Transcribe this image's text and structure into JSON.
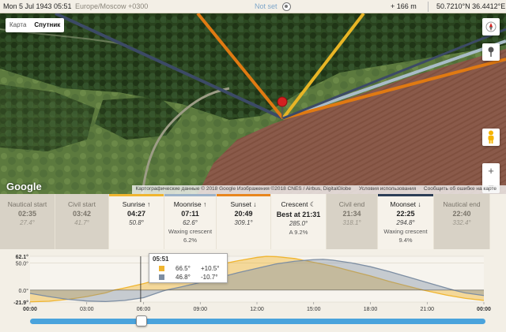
{
  "topbar": {
    "datetime": "Mon 5 Jul 1943 05:51",
    "timezone": "Europe/Moscow +0300",
    "notset": "Not set",
    "elevation": "+ 166 m",
    "coordinates": "50.7210°N 36.4412°E"
  },
  "map": {
    "type_labels": [
      "Карта",
      "Спутник"
    ],
    "active_type": "Спутник",
    "logo": "Google",
    "attribution": [
      "Картографические данные © 2018 Google Изображения ©2018 CNES / Airbus, DigitalGlobe",
      "Условия использования",
      "Сообщить об ошибке на карте"
    ],
    "zoom_in": "+",
    "zoom_out": "−"
  },
  "events": [
    {
      "name": "Nautical start",
      "time": "02:35",
      "sub": "27.4°",
      "style": "grey",
      "bar": ""
    },
    {
      "name": "Civil start",
      "time": "03:42",
      "sub": "41.7°",
      "style": "grey",
      "bar": ""
    },
    {
      "name": "Sunrise ↑",
      "time": "04:27",
      "sub": "50.8°",
      "style": "light",
      "bar": "#f0b530"
    },
    {
      "name": "Moonrise ↑",
      "time": "07:11",
      "sub": "62.6°",
      "sub2": "Waxing crescent",
      "sub3": "6.2%",
      "style": "light",
      "bar": "#9db3c9"
    },
    {
      "name": "Sunset ↓",
      "time": "20:49",
      "sub": "309.1°",
      "style": "light",
      "bar": "#e8861e"
    },
    {
      "name": "Crescent ☾",
      "time": "Best at 21:31",
      "sub": "285.0°",
      "sub2": "A 9.2%",
      "style": "light",
      "bar": ""
    },
    {
      "name": "Civil end",
      "time": "21:34",
      "sub": "318.1°",
      "style": "grey",
      "bar": ""
    },
    {
      "name": "Moonset ↓",
      "time": "22:25",
      "sub": "294.8°",
      "sub2": "Waxing crescent",
      "sub3": "9.4%",
      "style": "light",
      "bar": "#2c3e56"
    },
    {
      "name": "Nautical end",
      "time": "22:40",
      "sub": "332.4°",
      "style": "grey",
      "bar": ""
    }
  ],
  "tooltip": {
    "time": "05:51",
    "rows": [
      {
        "color": "#f0b530",
        "azimuth": "66.5°",
        "altitude": "+10.5°"
      },
      {
        "color": "#7d8ea3",
        "azimuth": "46.8°",
        "altitude": "-10.7°"
      }
    ]
  },
  "chart_data": {
    "type": "area",
    "x_ticks": [
      "00:00",
      "03:00",
      "06:00",
      "09:00",
      "12:00",
      "15:00",
      "18:00",
      "21:00",
      "00:00"
    ],
    "y_labels": [
      "62.1°",
      "50.0°",
      "0.0°",
      "-21.9°"
    ],
    "ylim": [
      -21.9,
      62.1
    ],
    "series": [
      {
        "color": "#f0b530",
        "x": [
          0,
          1,
          2,
          3,
          4,
          4.45,
          5,
          6,
          7,
          8,
          9,
          10,
          11,
          12,
          12.5,
          13,
          14,
          15,
          16,
          17,
          18,
          19,
          20,
          20.8,
          22,
          23,
          24
        ],
        "y": [
          -21.5,
          -20.5,
          -17,
          -12,
          -5,
          0,
          4,
          12,
          21,
          30,
          39,
          47,
          54,
          60,
          62,
          61.5,
          58,
          51,
          44,
          35,
          26,
          16,
          7,
          0,
          -9,
          -15,
          -19
        ]
      },
      {
        "color": "#7d8ea3",
        "x": [
          0,
          1,
          2,
          3,
          4,
          5,
          6,
          7,
          7.2,
          8,
          9,
          10,
          11,
          12,
          13,
          14,
          15,
          15.5,
          16,
          17,
          18,
          19,
          20,
          21,
          22,
          22.4,
          23,
          24
        ],
        "y": [
          -6,
          -12,
          -17,
          -20,
          -21,
          -19,
          -14,
          -2,
          0,
          6,
          14,
          23,
          32,
          40,
          48,
          53,
          56,
          56.5,
          55,
          50,
          43,
          34,
          24,
          14,
          4,
          0,
          -5,
          -10
        ]
      }
    ]
  },
  "slider": {
    "value_fraction": 0.244
  }
}
